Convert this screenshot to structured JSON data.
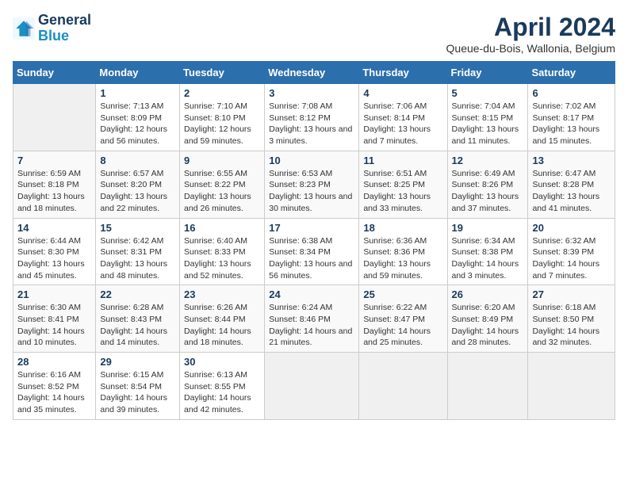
{
  "logo": {
    "line1": "General",
    "line2": "Blue"
  },
  "title": "April 2024",
  "subtitle": "Queue-du-Bois, Wallonia, Belgium",
  "weekdays": [
    "Sunday",
    "Monday",
    "Tuesday",
    "Wednesday",
    "Thursday",
    "Friday",
    "Saturday"
  ],
  "weeks": [
    [
      {
        "day": "",
        "empty": true
      },
      {
        "day": "1",
        "sunrise": "Sunrise: 7:13 AM",
        "sunset": "Sunset: 8:09 PM",
        "daylight": "Daylight: 12 hours and 56 minutes."
      },
      {
        "day": "2",
        "sunrise": "Sunrise: 7:10 AM",
        "sunset": "Sunset: 8:10 PM",
        "daylight": "Daylight: 12 hours and 59 minutes."
      },
      {
        "day": "3",
        "sunrise": "Sunrise: 7:08 AM",
        "sunset": "Sunset: 8:12 PM",
        "daylight": "Daylight: 13 hours and 3 minutes."
      },
      {
        "day": "4",
        "sunrise": "Sunrise: 7:06 AM",
        "sunset": "Sunset: 8:14 PM",
        "daylight": "Daylight: 13 hours and 7 minutes."
      },
      {
        "day": "5",
        "sunrise": "Sunrise: 7:04 AM",
        "sunset": "Sunset: 8:15 PM",
        "daylight": "Daylight: 13 hours and 11 minutes."
      },
      {
        "day": "6",
        "sunrise": "Sunrise: 7:02 AM",
        "sunset": "Sunset: 8:17 PM",
        "daylight": "Daylight: 13 hours and 15 minutes."
      }
    ],
    [
      {
        "day": "7",
        "sunrise": "Sunrise: 6:59 AM",
        "sunset": "Sunset: 8:18 PM",
        "daylight": "Daylight: 13 hours and 18 minutes."
      },
      {
        "day": "8",
        "sunrise": "Sunrise: 6:57 AM",
        "sunset": "Sunset: 8:20 PM",
        "daylight": "Daylight: 13 hours and 22 minutes."
      },
      {
        "day": "9",
        "sunrise": "Sunrise: 6:55 AM",
        "sunset": "Sunset: 8:22 PM",
        "daylight": "Daylight: 13 hours and 26 minutes."
      },
      {
        "day": "10",
        "sunrise": "Sunrise: 6:53 AM",
        "sunset": "Sunset: 8:23 PM",
        "daylight": "Daylight: 13 hours and 30 minutes."
      },
      {
        "day": "11",
        "sunrise": "Sunrise: 6:51 AM",
        "sunset": "Sunset: 8:25 PM",
        "daylight": "Daylight: 13 hours and 33 minutes."
      },
      {
        "day": "12",
        "sunrise": "Sunrise: 6:49 AM",
        "sunset": "Sunset: 8:26 PM",
        "daylight": "Daylight: 13 hours and 37 minutes."
      },
      {
        "day": "13",
        "sunrise": "Sunrise: 6:47 AM",
        "sunset": "Sunset: 8:28 PM",
        "daylight": "Daylight: 13 hours and 41 minutes."
      }
    ],
    [
      {
        "day": "14",
        "sunrise": "Sunrise: 6:44 AM",
        "sunset": "Sunset: 8:30 PM",
        "daylight": "Daylight: 13 hours and 45 minutes."
      },
      {
        "day": "15",
        "sunrise": "Sunrise: 6:42 AM",
        "sunset": "Sunset: 8:31 PM",
        "daylight": "Daylight: 13 hours and 48 minutes."
      },
      {
        "day": "16",
        "sunrise": "Sunrise: 6:40 AM",
        "sunset": "Sunset: 8:33 PM",
        "daylight": "Daylight: 13 hours and 52 minutes."
      },
      {
        "day": "17",
        "sunrise": "Sunrise: 6:38 AM",
        "sunset": "Sunset: 8:34 PM",
        "daylight": "Daylight: 13 hours and 56 minutes."
      },
      {
        "day": "18",
        "sunrise": "Sunrise: 6:36 AM",
        "sunset": "Sunset: 8:36 PM",
        "daylight": "Daylight: 13 hours and 59 minutes."
      },
      {
        "day": "19",
        "sunrise": "Sunrise: 6:34 AM",
        "sunset": "Sunset: 8:38 PM",
        "daylight": "Daylight: 14 hours and 3 minutes."
      },
      {
        "day": "20",
        "sunrise": "Sunrise: 6:32 AM",
        "sunset": "Sunset: 8:39 PM",
        "daylight": "Daylight: 14 hours and 7 minutes."
      }
    ],
    [
      {
        "day": "21",
        "sunrise": "Sunrise: 6:30 AM",
        "sunset": "Sunset: 8:41 PM",
        "daylight": "Daylight: 14 hours and 10 minutes."
      },
      {
        "day": "22",
        "sunrise": "Sunrise: 6:28 AM",
        "sunset": "Sunset: 8:43 PM",
        "daylight": "Daylight: 14 hours and 14 minutes."
      },
      {
        "day": "23",
        "sunrise": "Sunrise: 6:26 AM",
        "sunset": "Sunset: 8:44 PM",
        "daylight": "Daylight: 14 hours and 18 minutes."
      },
      {
        "day": "24",
        "sunrise": "Sunrise: 6:24 AM",
        "sunset": "Sunset: 8:46 PM",
        "daylight": "Daylight: 14 hours and 21 minutes."
      },
      {
        "day": "25",
        "sunrise": "Sunrise: 6:22 AM",
        "sunset": "Sunset: 8:47 PM",
        "daylight": "Daylight: 14 hours and 25 minutes."
      },
      {
        "day": "26",
        "sunrise": "Sunrise: 6:20 AM",
        "sunset": "Sunset: 8:49 PM",
        "daylight": "Daylight: 14 hours and 28 minutes."
      },
      {
        "day": "27",
        "sunrise": "Sunrise: 6:18 AM",
        "sunset": "Sunset: 8:50 PM",
        "daylight": "Daylight: 14 hours and 32 minutes."
      }
    ],
    [
      {
        "day": "28",
        "sunrise": "Sunrise: 6:16 AM",
        "sunset": "Sunset: 8:52 PM",
        "daylight": "Daylight: 14 hours and 35 minutes."
      },
      {
        "day": "29",
        "sunrise": "Sunrise: 6:15 AM",
        "sunset": "Sunset: 8:54 PM",
        "daylight": "Daylight: 14 hours and 39 minutes."
      },
      {
        "day": "30",
        "sunrise": "Sunrise: 6:13 AM",
        "sunset": "Sunset: 8:55 PM",
        "daylight": "Daylight: 14 hours and 42 minutes."
      },
      {
        "day": "",
        "empty": true
      },
      {
        "day": "",
        "empty": true
      },
      {
        "day": "",
        "empty": true
      },
      {
        "day": "",
        "empty": true
      }
    ]
  ]
}
